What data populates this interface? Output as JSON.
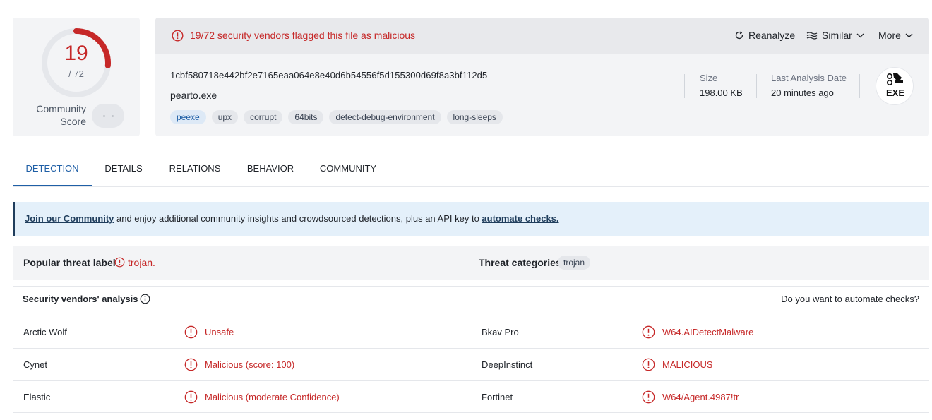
{
  "colors": {
    "malicious": "#c62828",
    "accent": "#1f5fa6",
    "banner_border": "#1f3d5c"
  },
  "score": {
    "detections": "19",
    "total": "/ 72",
    "detection_fraction": 0.2639,
    "community_label_line1": "Community",
    "community_label_line2": "Score"
  },
  "header": {
    "alert_icon": "alert-circle-icon",
    "alert_text": "19/72 security vendors flagged this file as malicious",
    "reanalyze_label": "Reanalyze",
    "similar_label": "Similar",
    "more_label": "More",
    "hash": "1cbf580718e442bf2e7165eaa064e8e40d6b54556f5d155300d69f8a3bf112d5",
    "filename": "pearto.exe",
    "tags": [
      "peexe",
      "upx",
      "corrupt",
      "64bits",
      "detect-debug-environment",
      "long-sleeps"
    ],
    "size_label": "Size",
    "size_value": "198.00 KB",
    "last_analysis_label": "Last Analysis Date",
    "last_analysis_value": "20 minutes ago",
    "file_type_label": "EXE"
  },
  "tabs": [
    "DETECTION",
    "DETAILS",
    "RELATIONS",
    "BEHAVIOR",
    "COMMUNITY"
  ],
  "banner": {
    "link1": "Join our Community",
    "middle": " and enjoy additional community insights and crowdsourced detections, plus an API key to ",
    "link2": "automate checks."
  },
  "threat": {
    "popular_label": "Popular threat label",
    "popular_value": "trojan.",
    "categories_label": "Threat categories",
    "categories_value": "trojan"
  },
  "vendors_header": {
    "title": "Security vendors' analysis",
    "automate_prompt": "Do you want to automate checks?"
  },
  "vendors": [
    {
      "left_name": "Arctic Wolf",
      "left_result": "Unsafe",
      "right_name": "Bkav Pro",
      "right_result": "W64.AIDetectMalware"
    },
    {
      "left_name": "Cynet",
      "left_result": "Malicious (score: 100)",
      "right_name": "DeepInstinct",
      "right_result": "MALICIOUS"
    },
    {
      "left_name": "Elastic",
      "left_result": "Malicious (moderate Confidence)",
      "right_name": "Fortinet",
      "right_result": "W64/Agent.4987!tr"
    }
  ]
}
